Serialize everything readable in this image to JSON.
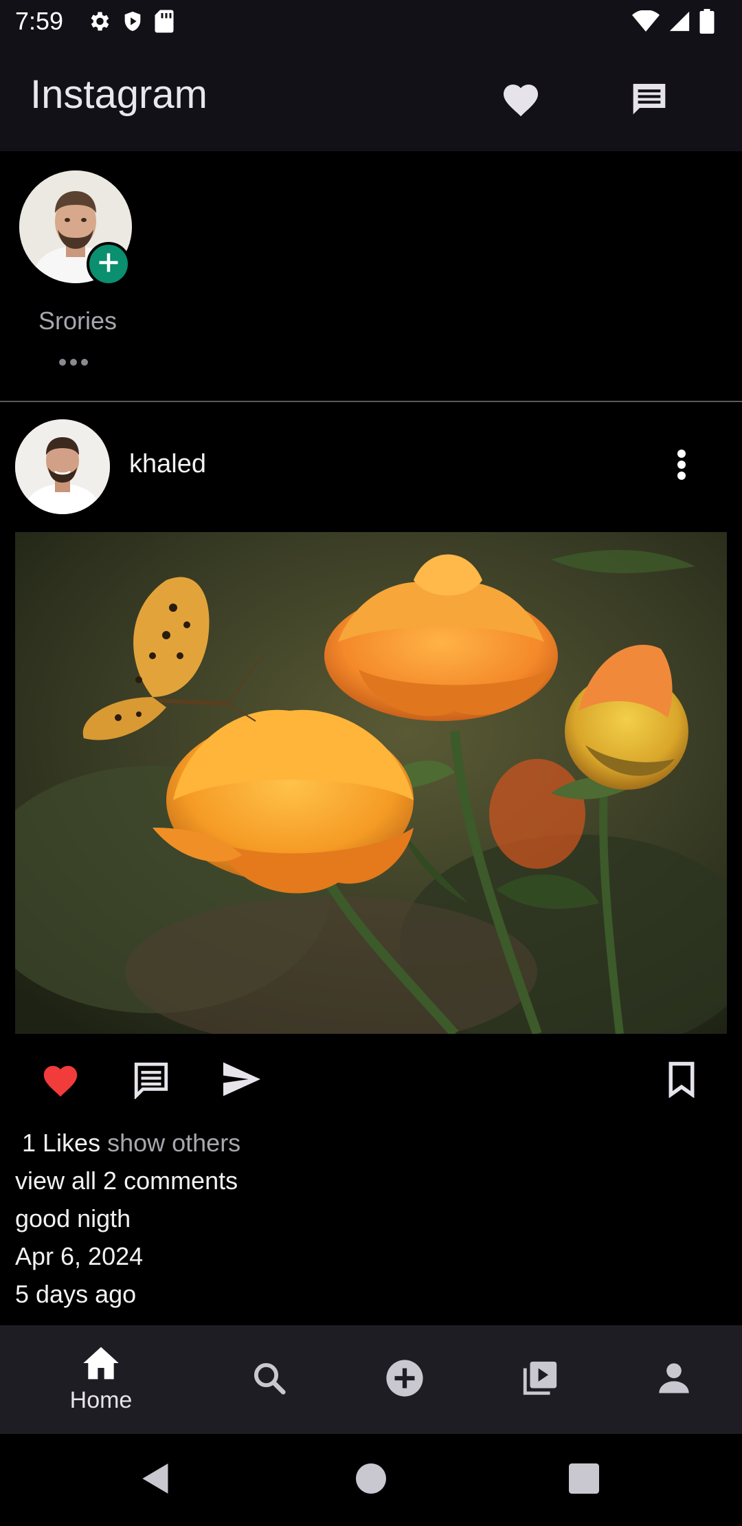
{
  "status_bar": {
    "time": "7:59",
    "left_icons": [
      "gear-icon",
      "shield-icon",
      "sd-card-icon"
    ],
    "right_icons": [
      "wifi-icon",
      "signal-icon",
      "battery-icon"
    ]
  },
  "app_bar": {
    "title": "Instagram",
    "actions": [
      "heart-icon",
      "message-icon"
    ]
  },
  "stories": {
    "label": "Srories",
    "add_icon": "plus-icon"
  },
  "post": {
    "username": "khaled",
    "menu_icon": "more-vert-icon",
    "image_description_icon": "photo",
    "actions": {
      "like_icon": "heart-icon",
      "comment_icon": "comment-icon",
      "share_icon": "send-icon",
      "save_icon": "bookmark-icon"
    },
    "likes_count": " 1 Likes",
    "likes_others": "show others",
    "view_comments": "view all 2 comments",
    "caption": "good nigth",
    "date": "Apr 6, 2024",
    "relative_time": "5 days ago"
  },
  "bottom_nav": {
    "items": [
      {
        "icon": "home-icon",
        "label": "Home",
        "active": true
      },
      {
        "icon": "search-icon",
        "label": "",
        "active": false
      },
      {
        "icon": "add-circle-icon",
        "label": "",
        "active": false
      },
      {
        "icon": "video-library-icon",
        "label": "",
        "active": false
      },
      {
        "icon": "person-icon",
        "label": "",
        "active": false
      }
    ]
  },
  "system_nav": [
    "back-icon",
    "home-circle-icon",
    "recents-icon"
  ],
  "colors": {
    "background": "#000000",
    "app_bar": "#131118",
    "bottom_nav": "#1f1d24",
    "like_red": "#f23b3b",
    "story_add_green": "#0a8f6f",
    "muted_text": "#a9a7ae"
  }
}
